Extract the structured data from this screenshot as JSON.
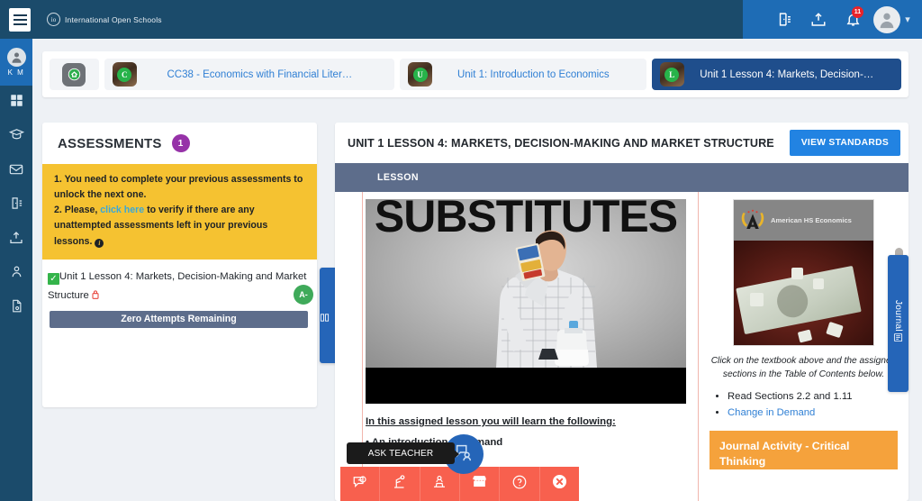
{
  "topbar": {
    "menu_label": "menu",
    "brand": "International Open Schools",
    "brand_mark": "io",
    "notifications_count": "11",
    "icons": [
      "door-exit-icon",
      "upload-inbox-icon",
      "bell-icon",
      "user-avatar-icon",
      "chevron-down-icon"
    ]
  },
  "rail": {
    "initials": "K M",
    "items": [
      {
        "name": "dashboard",
        "icon": "grid-icon"
      },
      {
        "name": "courses",
        "icon": "graduation-cap-icon"
      },
      {
        "name": "messages",
        "icon": "envelope-icon"
      },
      {
        "name": "exit",
        "icon": "door-exit-icon"
      },
      {
        "name": "submissions",
        "icon": "upload-inbox-icon"
      },
      {
        "name": "profile",
        "icon": "person-icon"
      },
      {
        "name": "reports",
        "icon": "document-icon"
      }
    ]
  },
  "breadcrumb": {
    "home_icon": "home-icon",
    "items": [
      {
        "letter": "C",
        "label": "CC38 - Economics with Financial Liter…",
        "active": false
      },
      {
        "letter": "U",
        "label": "Unit 1: Introduction to Economics",
        "active": false
      },
      {
        "letter": "L",
        "label": "Unit 1 Lesson 4: Markets, Decision-…",
        "active": true
      }
    ]
  },
  "assessments": {
    "title": "ASSESSMENTS",
    "badge": "1",
    "note_line1": "1. You need to complete your previous assessments to unlock the next one.",
    "note_line2_pre": "2. Please, ",
    "note_link": "click here",
    "note_line2_post": " to verify if there are any unattempted assessments left in your previous lessons. ",
    "item_title": "Unit 1 Lesson 4: Markets, Decision-Making and Market Structure",
    "grade": "A-",
    "attempts": "Zero Attempts Remaining",
    "side_tab": "Assessments"
  },
  "main": {
    "title": "UNIT 1 LESSON 4: MARKETS, DECISION-MAKING AND MARKET STRUCTURE",
    "view_standards": "VIEW STANDARDS",
    "tab_lesson": "LESSON",
    "video_word": "SUBSTITUTES",
    "lead_text": "In this assigned lesson you will learn the following:",
    "lead_sub": "• An introduction to demand",
    "book_brand": "American HS Economics",
    "book_caption": "Click on the textbook above and the assigned sections in the Table of Contents below.",
    "book_list": [
      "Read Sections 2.2 and 1.11"
    ],
    "book_link": "Change in Demand",
    "journal_box": "Journal Activity - Critical Thinking",
    "journal_tab": "Journal"
  },
  "dock": {
    "ask_teacher_tooltip": "ASK TEACHER",
    "ask_teacher_icon": "ask-teacher-icon",
    "items": [
      {
        "name": "chat",
        "icon": "chat-bubble-icon"
      },
      {
        "name": "tools",
        "icon": "robot-arm-icon"
      },
      {
        "name": "study",
        "icon": "student-desk-icon"
      },
      {
        "name": "store",
        "icon": "store-icon"
      },
      {
        "name": "help",
        "icon": "question-circle-icon"
      },
      {
        "name": "close",
        "icon": "close-circle-icon"
      }
    ]
  },
  "colors": {
    "header_dark": "#1b4b6b",
    "header_blue": "#1e6cb5",
    "accent_blue": "#2283e2",
    "warning_yellow": "#f5c231",
    "dock_red": "#f8604e",
    "orange": "#f5a23c",
    "purple_badge": "#9632a8",
    "green": "#34b44a",
    "slate": "#5d6d8b"
  }
}
